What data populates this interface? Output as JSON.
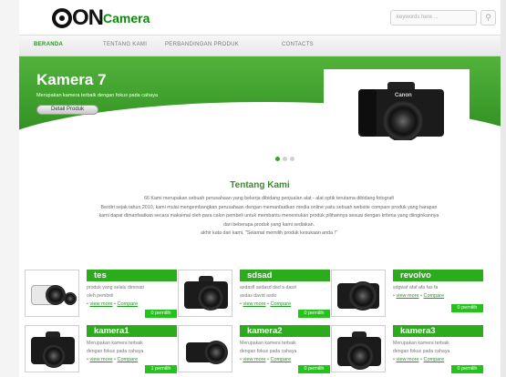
{
  "header": {
    "logo_big": "ON",
    "logo_small": "Camera",
    "search_placeholder": "keywords here ...",
    "search_icon": "search-icon"
  },
  "nav": {
    "items": [
      {
        "label": "BERANDA",
        "active": true
      },
      {
        "label": "TENTANG KAMI",
        "active": false
      },
      {
        "label": "PERBANDINGAN PRODUK",
        "active": false
      },
      {
        "label": "CONTACTS",
        "active": false
      }
    ]
  },
  "banner": {
    "title": "Kamera 7",
    "subtitle": "Merupakan kamera terbaik dengan fokus pada cahaya",
    "button": "Detail Produk",
    "camera_brand": "Canon"
  },
  "slider": {
    "total": 3,
    "current": 1
  },
  "about": {
    "title": "Tentang Kami",
    "lines": [
      "66 Kami merupakan sebuah perusahaan yang bekerja dibidang penjualan alat - alat optik terutama dibidang fotografi",
      "Berdiri sejak tahun 2010, kami mulai mengembangkan perusahaan dengan memanfaatkan media online yaitu sebuah website compare produk yang harapan",
      "kami dapat dimanfaatkan secara maksimal oleh para calon pembeli untuk membantu menentukan produk pilihannya sesuai dengan kriteria yang diinginkannya",
      "dari beberapa produk yang kami sediakan.",
      "akhir kata dari kami, \"Selamat memilih produk kesukaan anda !\""
    ]
  },
  "products": [
    {
      "title": "tes",
      "desc": [
        "produk yang selalu diminati",
        "oleh pembeli"
      ],
      "view": "view more",
      "compare": "Compare",
      "badge": "0 pemilih"
    },
    {
      "title": "sdsad",
      "desc": [
        "asdasfl asdasd dad a dasd",
        "asdas david asdo"
      ],
      "view": "view more",
      "compare": "Compare",
      "badge": "0 pemilih"
    },
    {
      "title": "revolvo",
      "desc": [
        "sdgwaf afaf afa fas fa"
      ],
      "view": "view more",
      "compare": "Compare",
      "badge": "0 pemilih"
    },
    {
      "title": "kamera1",
      "desc": [
        "Merupakan kamera terbaik",
        "dengan fokus pada cahaya"
      ],
      "view": "view more",
      "compare": "Compare",
      "badge": "1 pemilih"
    },
    {
      "title": "kamera2",
      "desc": [
        "Merupakan kamera terbaik",
        "dengan fokus pada cahaya"
      ],
      "view": "view more",
      "compare": "Compare",
      "badge": "0 pemilih"
    },
    {
      "title": "kamera3",
      "desc": [
        "Merupakan kamera terbaik",
        "dengan fokus pada cahaya"
      ],
      "view": "view more",
      "compare": "Compare",
      "badge": "0 pemilih"
    }
  ],
  "colors": {
    "brand_green": "#2cab1d",
    "badge_green": "#22c41a",
    "link_green": "#1c9c1c"
  }
}
